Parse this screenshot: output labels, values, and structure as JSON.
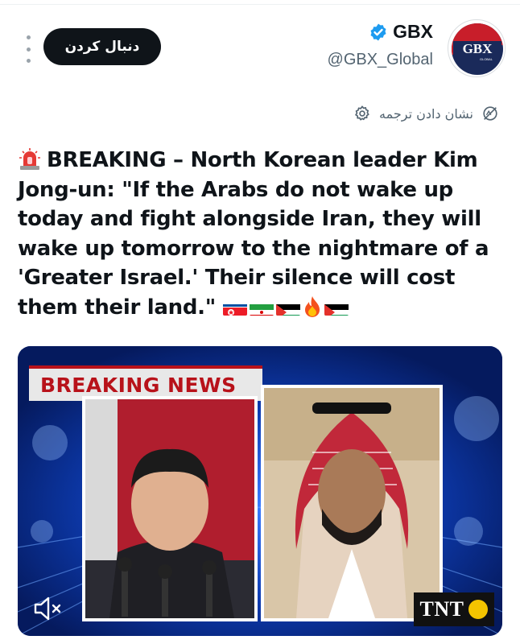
{
  "header": {
    "display_name": "GBX",
    "handle": "@GBX_Global",
    "follow_label": "دنبال کردن",
    "avatar_text": "GBX",
    "avatar_subtext": "GLOBAL"
  },
  "translate": {
    "label": "نشان دادن ترجمه"
  },
  "post": {
    "text": "BREAKING – North Korean leader Kim Jong-un: \"If the Arabs do not wake up today and fight alongside Iran, they will wake up tomorrow to the nightmare of a 'Greater Israel.' Their silence will cost them their land.\"",
    "emoji": [
      "police-siren",
      "flag-north-korea",
      "flag-iran",
      "flag-palestine",
      "fire",
      "flag-palestine"
    ]
  },
  "media": {
    "banner": "BREAKING NEWS",
    "watermark": "TNT"
  },
  "colors": {
    "text": "#0f1419",
    "secondary": "#536471",
    "verified": "#1d9bf0",
    "banner_red": "#b8121a",
    "media_blue": "#0a2a8a"
  }
}
